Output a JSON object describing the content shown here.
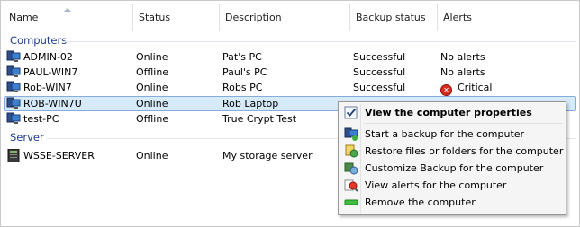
{
  "header": {
    "columns": [
      "Name",
      "Status",
      "Description",
      "Backup status",
      "Alerts"
    ]
  },
  "groups": {
    "computers": {
      "title": "Computers",
      "rows": [
        {
          "name": "ADMIN-02",
          "status": "Online",
          "description": "Pat's PC",
          "backup_status": "Successful",
          "alerts": "No alerts"
        },
        {
          "name": "PAUL-WIN7",
          "status": "Offline",
          "description": "Paul's PC",
          "backup_status": "Successful",
          "alerts": "No alerts"
        },
        {
          "name": "Rob-WIN7",
          "status": "Online",
          "description": "Robs PC",
          "backup_status": "Successful",
          "alerts": "Critical"
        },
        {
          "name": "ROB-WIN7U",
          "status": "Online",
          "description": "Rob Laptop",
          "backup_status": "",
          "alerts": ""
        },
        {
          "name": "test-PC",
          "status": "Offline",
          "description": "True Crypt Test",
          "backup_status": "",
          "alerts": ""
        }
      ]
    },
    "server": {
      "title": "Server",
      "rows": [
        {
          "name": "WSSE-SERVER",
          "status": "Online",
          "description": "My storage server",
          "backup_status": "",
          "alerts": ""
        }
      ]
    }
  },
  "context_menu": {
    "items": [
      {
        "label": "View the computer properties",
        "icon": "properties-check-icon"
      },
      {
        "label": "Start a backup for the computer",
        "icon": "start-backup-icon"
      },
      {
        "label": "Restore files or folders for the computer",
        "icon": "restore-files-icon"
      },
      {
        "label": "Customize Backup for the computer",
        "icon": "customize-backup-icon"
      },
      {
        "label": "View alerts for the computer",
        "icon": "view-alerts-icon"
      },
      {
        "label": "Remove the computer",
        "icon": "remove-computer-icon"
      }
    ]
  },
  "colors": {
    "group_title": "#1e3d8f",
    "selection_fill": "#d7eaf9",
    "selection_border": "#84acdd",
    "critical": "#d82a1e"
  }
}
